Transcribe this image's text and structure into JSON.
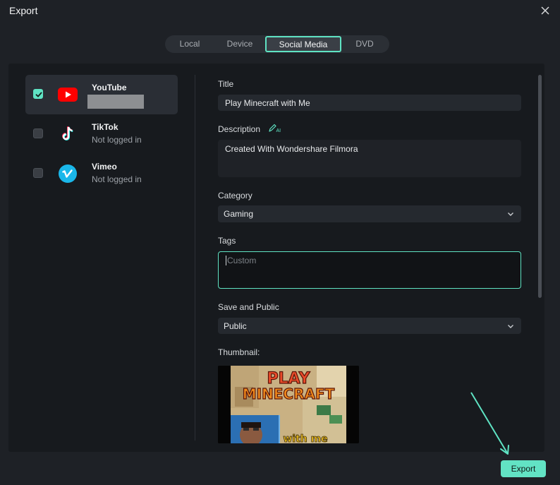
{
  "window": {
    "title": "Export"
  },
  "tabs": [
    {
      "label": "Local"
    },
    {
      "label": "Device"
    },
    {
      "label": "Social Media",
      "active": true
    },
    {
      "label": "DVD"
    }
  ],
  "platforms": [
    {
      "name": "YouTube",
      "status": "",
      "checked": true,
      "icon": "youtube-icon"
    },
    {
      "name": "TikTok",
      "status": "Not logged in",
      "checked": false,
      "icon": "tiktok-icon"
    },
    {
      "name": "Vimeo",
      "status": "Not logged in",
      "checked": false,
      "icon": "vimeo-icon"
    }
  ],
  "form": {
    "title_label": "Title",
    "title_value": "Play Minecraft with Me",
    "description_label": "Description",
    "ai_badge": "AI",
    "description_value": "Created With Wondershare Filmora",
    "category_label": "Category",
    "category_value": "Gaming",
    "tags_label": "Tags",
    "tags_placeholder": "Custom",
    "visibility_label": "Save and Public",
    "visibility_value": "Public",
    "thumbnail_label": "Thumbnail:"
  },
  "thumbnail": {
    "line1": "PLAY",
    "line2": "MINECRAFT",
    "line3": "with me"
  },
  "footer": {
    "export_label": "Export"
  },
  "colors": {
    "accent": "#5fe3c3",
    "youtube_red": "#ff0000",
    "vimeo_blue": "#1ab7ea",
    "background": "#1e2126",
    "panel": "#171a1e"
  }
}
